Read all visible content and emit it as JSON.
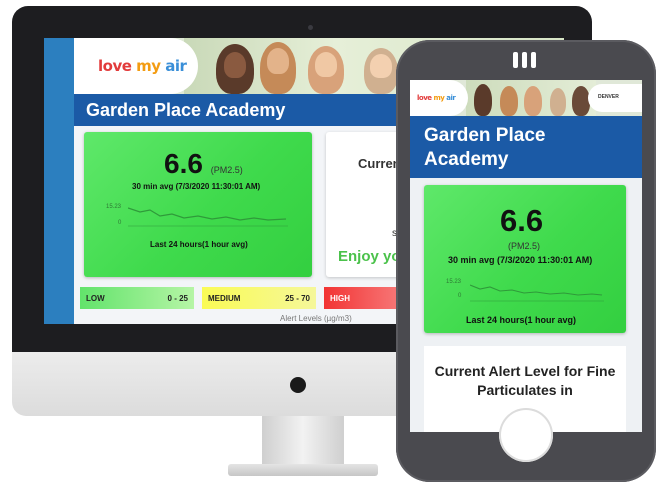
{
  "brand": {
    "word1": "love",
    "word2": "my",
    "word3": "air"
  },
  "desktop": {
    "school_name": "Garden Place Academy",
    "reading": {
      "value": "6.6",
      "unit": "(PM2.5)",
      "avg": "30 min avg (7/3/2020 11:30:01 AM)",
      "spark_max": "15.23",
      "spark_min": "0",
      "window": "Last 24 hours(1 hour avg)"
    },
    "alert_partial": "Curren",
    "alert_s": "s",
    "alert_enjoy_partial": "Enjoy yo",
    "legend": [
      {
        "label": "LOW",
        "range": "0 - 25"
      },
      {
        "label": "MEDIUM",
        "range": "25 - 70"
      },
      {
        "label": "HIGH",
        "range": ""
      }
    ],
    "legend_caption": "Alert Levels (µg/m3)"
  },
  "phone": {
    "partner_logo": "DENVER",
    "school_name": "Garden Place Academy",
    "reading": {
      "value": "6.6",
      "unit": "(PM2.5)",
      "avg": "30 min avg (7/3/2020 11:30:01 AM)",
      "spark_max": "15.23",
      "spark_min": "0",
      "window": "Last 24 hours(1 hour avg)"
    },
    "alert_heading": "Current Alert Level for Fine Particulates in"
  },
  "colors": {
    "header_blue": "#1b5aa6",
    "good_green": "#3fda4c",
    "medium_yellow": "#fafb55",
    "high_red": "#f23434"
  }
}
